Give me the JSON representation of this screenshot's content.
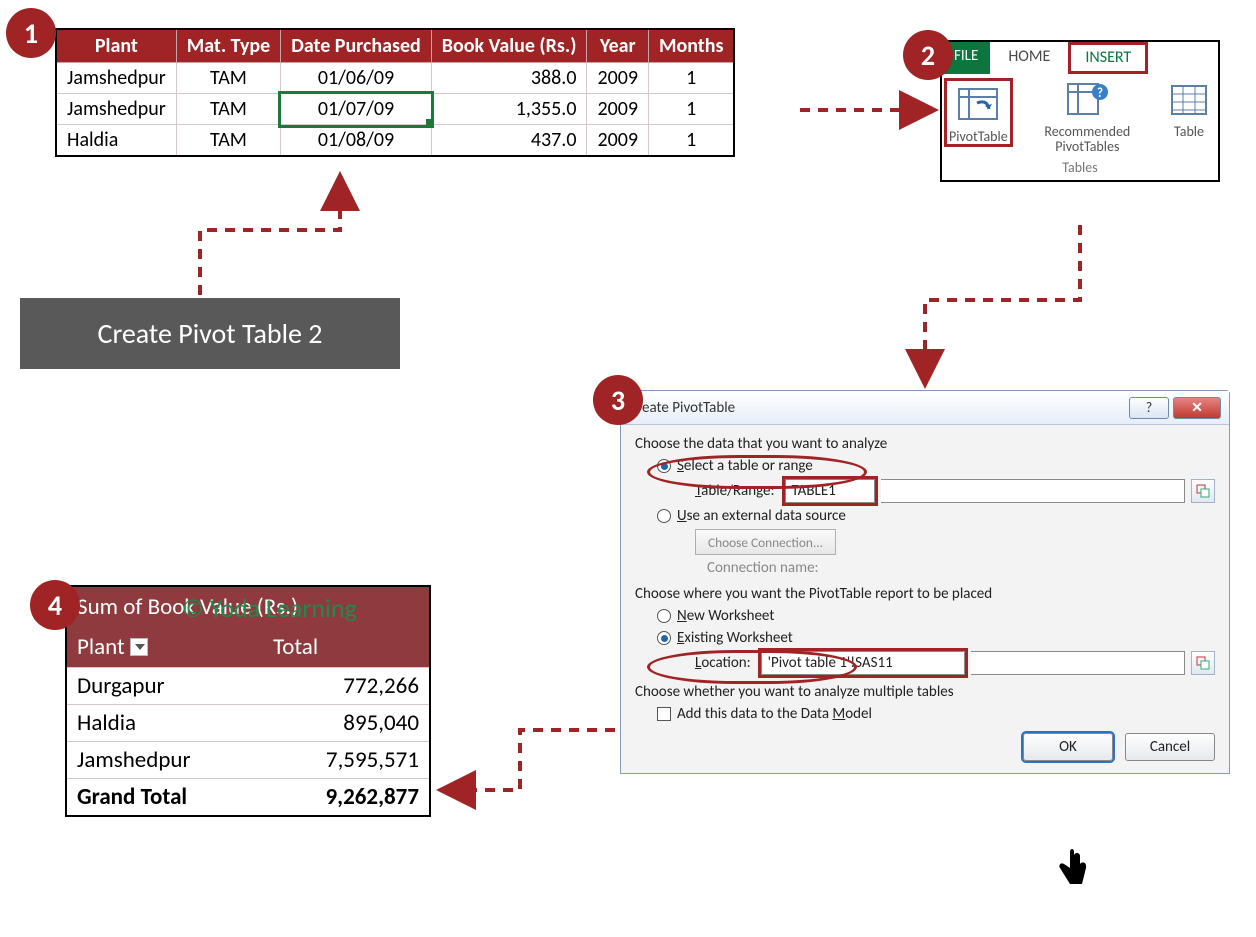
{
  "badges": {
    "b1": "1",
    "b2": "2",
    "b3": "3",
    "b4": "4"
  },
  "dataTable": {
    "headers": [
      "Plant",
      "Mat. Type",
      "Date Purchased",
      "Book Value (Rs.)",
      "Year",
      "Months"
    ],
    "rows": [
      {
        "plant": "Jamshedpur",
        "mat": "TAM",
        "date": "01/06/09",
        "book": "388.0",
        "year": "2009",
        "months": "1"
      },
      {
        "plant": "Jamshedpur",
        "mat": "TAM",
        "date": "01/07/09",
        "book": "1,355.0",
        "year": "2009",
        "months": "1"
      },
      {
        "plant": "Haldia",
        "mat": "TAM",
        "date": "01/08/09",
        "book": "437.0",
        "year": "2009",
        "months": "1"
      }
    ]
  },
  "ribbon": {
    "file": "FILE",
    "home": "HOME",
    "insert": "INSERT",
    "pivot": "PivotTable",
    "rec": "Recommended PivotTables",
    "table": "Table",
    "group": "Tables"
  },
  "caption": "Create Pivot Table 2",
  "dialog": {
    "title": "Create PivotTable",
    "sec1": "Choose the data that you want to analyze",
    "opt1": "Select a table or range",
    "rangeLbl": "Table/Range:",
    "rangeVal": "TABLE1",
    "opt2": "Use an external data source",
    "chooseConn": "Choose Connection...",
    "connName": "Connection name:",
    "sec2": "Choose where you want the PivotTable report to be placed",
    "opt3": "New Worksheet",
    "opt4": "Existing Worksheet",
    "locLbl": "Location:",
    "locVal": "'Pivot  table 1'!SAS11",
    "sec3": "Choose whether you want to analyze multiple tables",
    "chkLbl": "Add this data to the Data Model",
    "ok": "OK",
    "cancel": "Cancel"
  },
  "pivot": {
    "measure": "Sum of Book Value (Rs.)",
    "colPlant": "Plant",
    "colTotal": "Total",
    "rows": [
      {
        "k": "Durgapur",
        "v": "772,266"
      },
      {
        "k": "Haldia",
        "v": "895,040"
      },
      {
        "k": "Jamshedpur",
        "v": "7,595,571"
      }
    ],
    "gt": "Grand Total",
    "gtv": "9,262,877"
  },
  "watermark": "© Yoda Learning"
}
